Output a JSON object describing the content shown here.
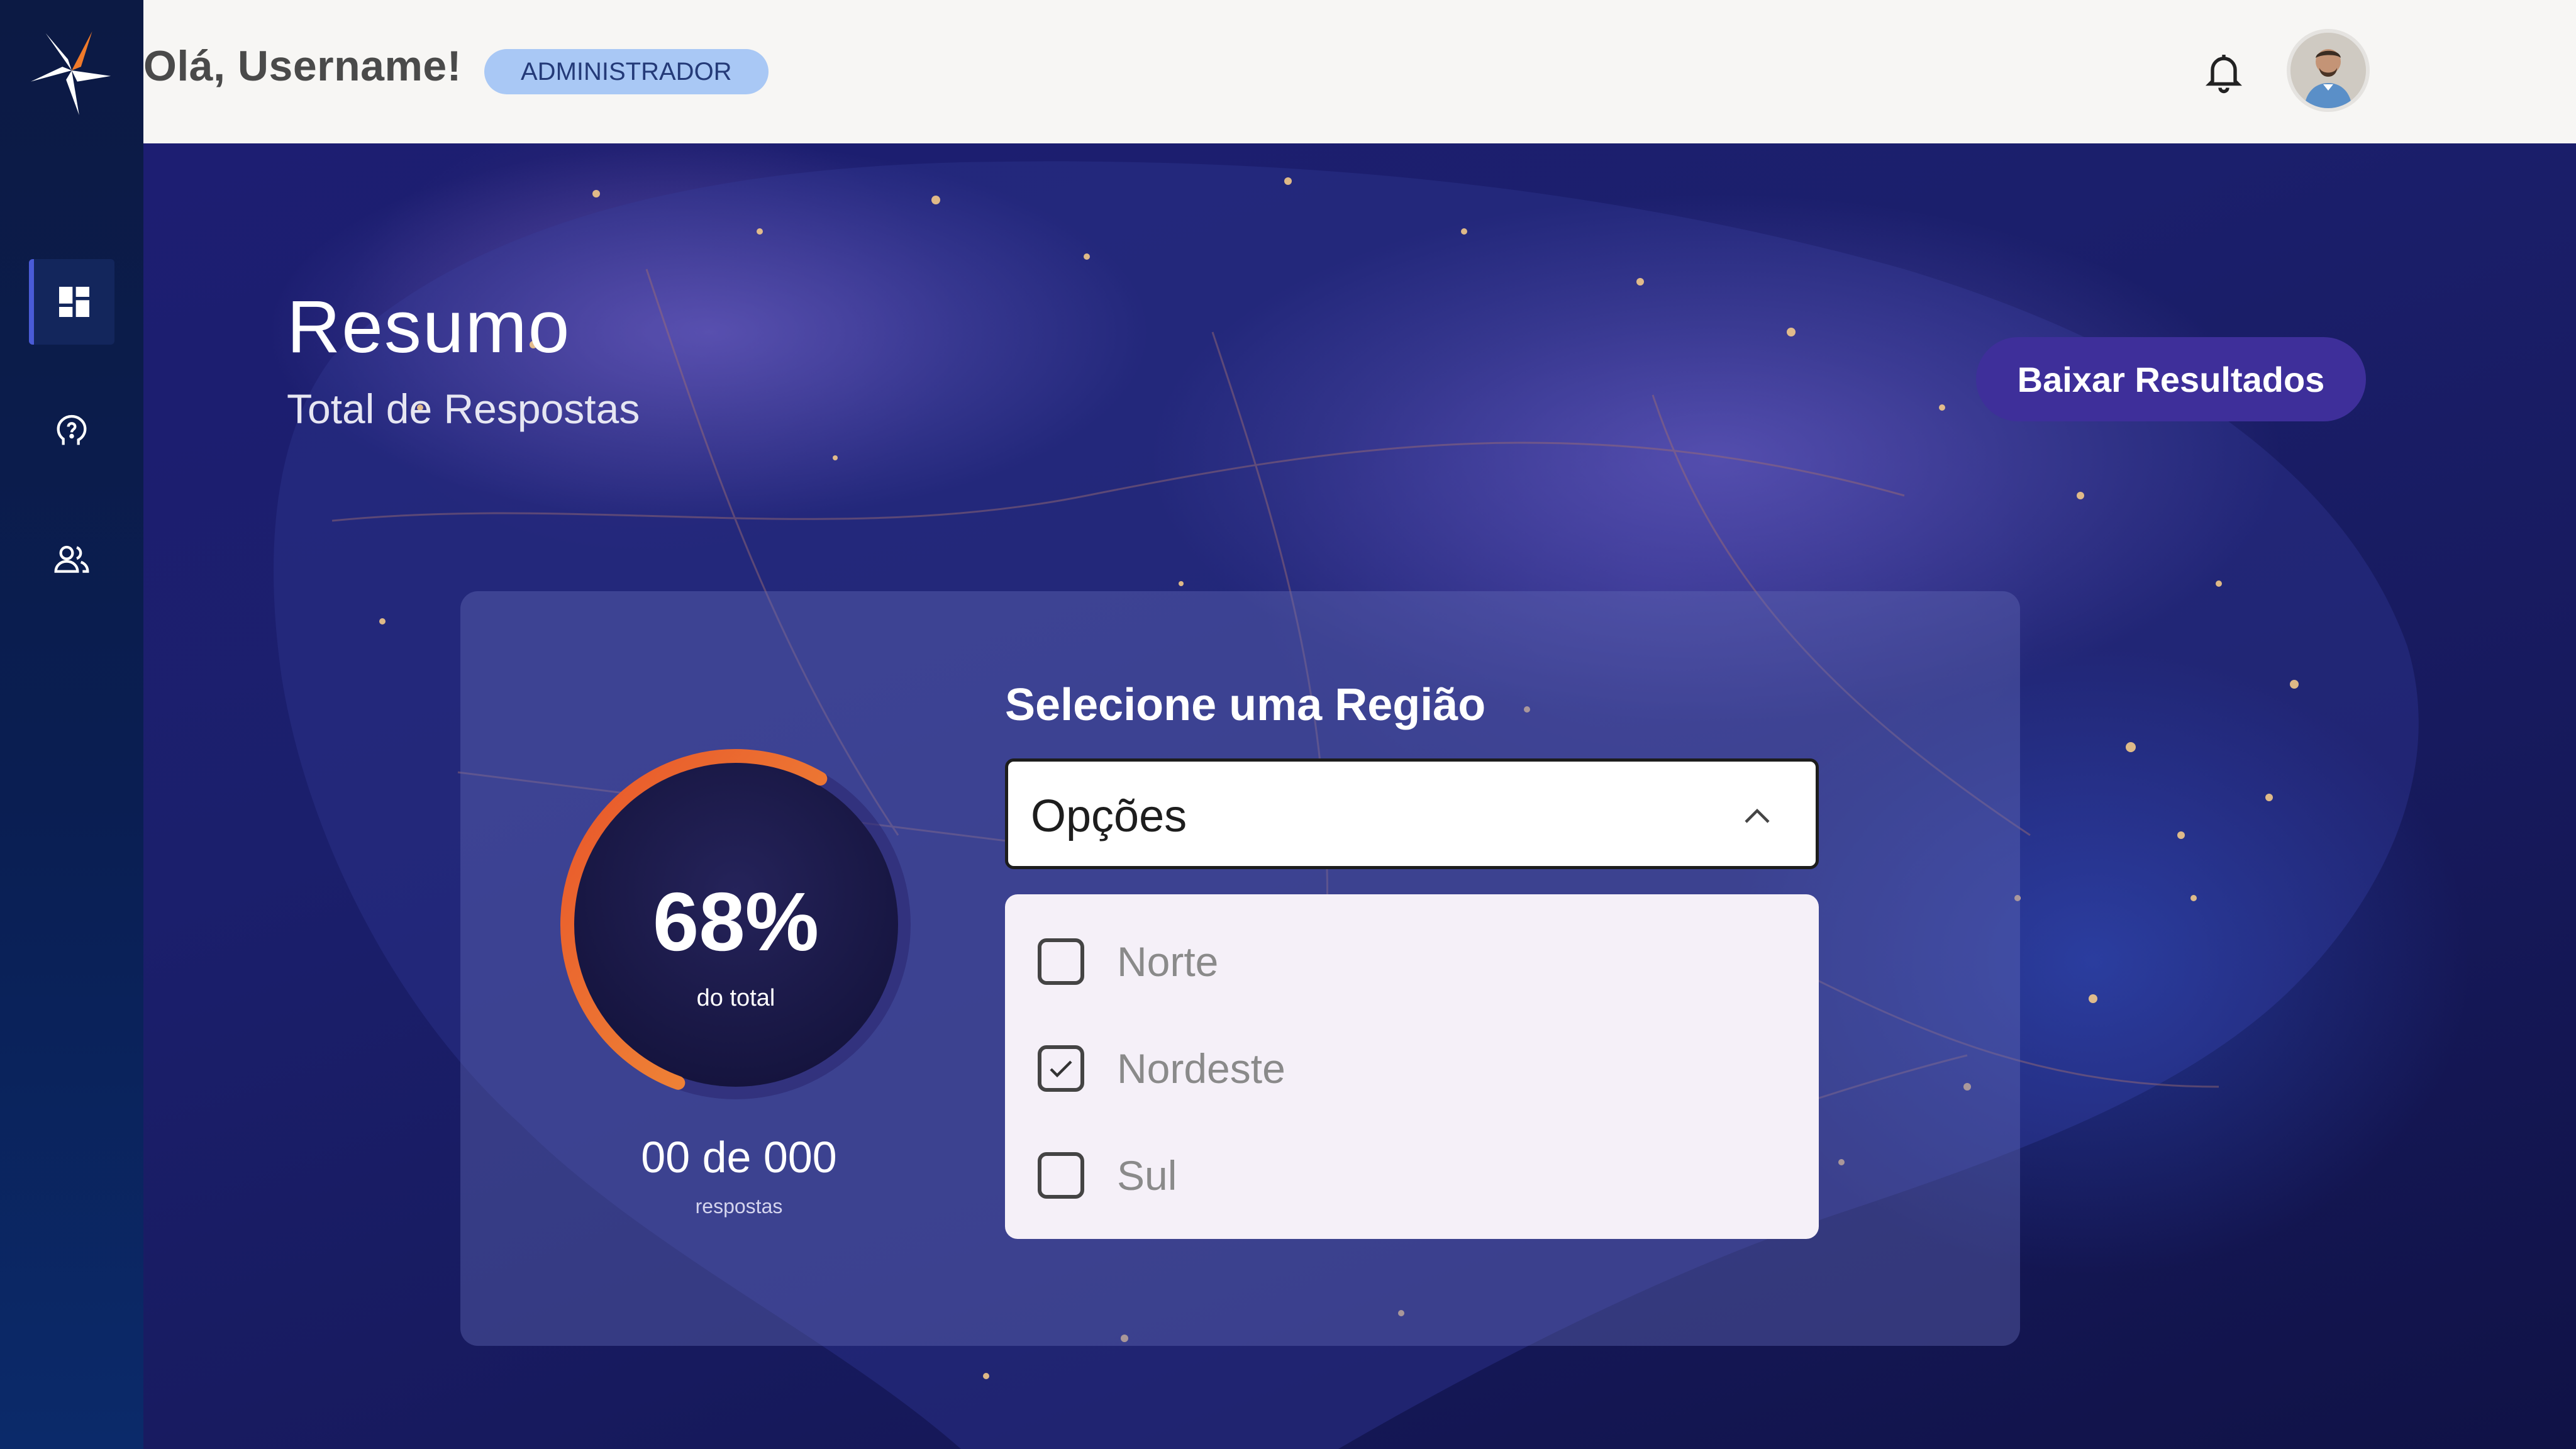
{
  "header": {
    "greeting": "Olá, Username!",
    "role_badge": "ADMINISTRADOR"
  },
  "sidebar": {
    "items": [
      {
        "icon": "dashboard-icon",
        "active": true
      },
      {
        "icon": "help-icon",
        "active": false
      },
      {
        "icon": "users-icon",
        "active": false
      }
    ]
  },
  "page": {
    "title": "Resumo",
    "subtitle": "Total de Respostas",
    "download_button": "Baixar Resultados"
  },
  "summary": {
    "percent": 68,
    "percent_text": "68%",
    "percent_caption": "do total",
    "count_text": "00 de 000",
    "count_caption": "respostas"
  },
  "region": {
    "label": "Selecione uma Região",
    "select_value": "Opções",
    "options": [
      {
        "label": "Norte",
        "checked": false
      },
      {
        "label": "Nordeste",
        "checked": true
      },
      {
        "label": "Sul",
        "checked": false
      }
    ]
  },
  "colors": {
    "accent": "#3e2f9a",
    "gauge_start": "#e8552a",
    "gauge_end": "#f0913a",
    "badge": "#a9c8f5"
  }
}
